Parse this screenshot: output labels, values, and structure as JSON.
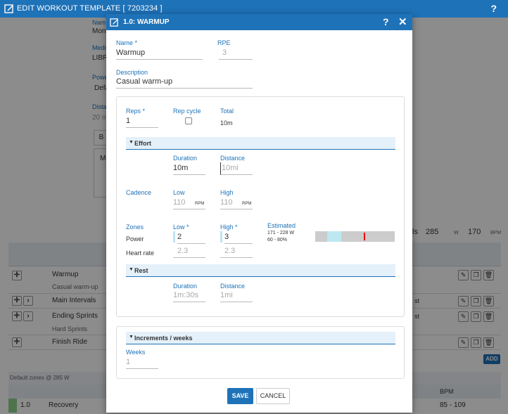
{
  "background": {
    "title": "EDIT WORKOUT TEMPLATE [ 7203234 ]",
    "help": "?",
    "fields": [
      {
        "label": "Nam",
        "value": "Mon"
      },
      {
        "label": "Medi",
        "value": "LIBR"
      },
      {
        "label": "Powe",
        "value": "Defa"
      },
      {
        "label": "Dista",
        "value": "20 m"
      }
    ],
    "editor_button": "B",
    "editor_text": "Mo",
    "right_row": {
      "label": "ls",
      "power": "285",
      "power_unit": "W",
      "hr": "170",
      "hr_unit": "BPM"
    },
    "rows": [
      {
        "name": "Warmup",
        "sub": "Casual warm-up",
        "status": ""
      },
      {
        "name": "Main Intervals",
        "sub": "",
        "status": "st"
      },
      {
        "name": "Ending Sprints",
        "sub": "Hard Sprints",
        "status": "st"
      },
      {
        "name": "Finish Ride",
        "sub": "",
        "status": ""
      }
    ],
    "add_label": "ADD",
    "zones_header": "Default zones @ 285 W",
    "zones_col": "BPM",
    "zone": {
      "number": "1.0",
      "name": "Recovery",
      "bpm": "85 - 109",
      "color": "#8fd48f"
    }
  },
  "modal": {
    "title": "1.0: WARMUP",
    "help": "?",
    "close": "✕",
    "name_label": "Name *",
    "name_value": "Warmup",
    "rpe_label": "RPE",
    "rpe_placeholder": "3",
    "description_label": "Description",
    "description_value": "Casual warm-up",
    "reps_label": "Reps *",
    "reps_value": "1",
    "rep_cycle_label": "Rep cycle",
    "total_label": "Total",
    "total_value": "10m",
    "effort": {
      "title": "Effort",
      "duration_label": "Duration",
      "duration_value": "10m",
      "distance_label": "Distance",
      "distance_placeholder": "10mi",
      "cadence_label": "Cadence",
      "cadence_low_label": "Low",
      "cadence_low_placeholder": "110",
      "cadence_high_label": "High",
      "cadence_high_placeholder": "110",
      "rpm_unit": "RPM",
      "zones_label": "Zones",
      "zones_low_label": "Low *",
      "zones_high_label": "High *",
      "estimated_label": "Estimated",
      "power_label": "Power",
      "power_low": "2",
      "power_high": "3",
      "estimated_power": "171 - 228 W",
      "estimated_hr": "60 - 80%",
      "hr_label": "Heart rate",
      "hr_low_placeholder": "2.3",
      "hr_high_placeholder": "2.3",
      "bar_fill_color": "#bde8f2",
      "bar_tick_color": "#ee0000"
    },
    "rest": {
      "title": "Rest",
      "duration_label": "Duration",
      "duration_placeholder": "1m:30s",
      "distance_label": "Distance",
      "distance_placeholder": "1mi"
    },
    "increments": {
      "title": "Increments / weeks",
      "weeks_label": "Weeks",
      "weeks_placeholder": "1"
    },
    "save_label": "SAVE",
    "cancel_label": "CANCEL"
  },
  "colors": {
    "brand": "#1e72b8",
    "section_bg": "#e4f0fa"
  }
}
